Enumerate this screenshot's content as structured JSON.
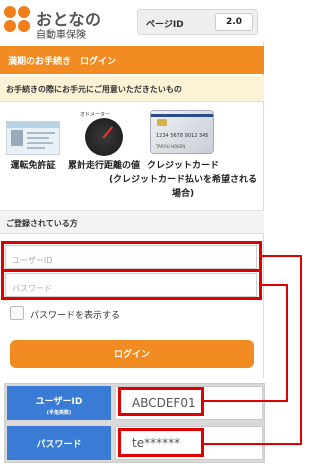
{
  "header": {
    "logo_main": "おとなの",
    "logo_sub": "自動車保険",
    "page_id_label": "ページID",
    "page_id_value": "2.0"
  },
  "title_bar": "満期のお手続き　ログイン",
  "notice": "お手続きの際にお手元にご用意いただきたいもの",
  "items": [
    {
      "caption": "運転免許証",
      "icon": "drivers-license-icon"
    },
    {
      "caption": "累計走行距離の値",
      "icon": "odometer-icon",
      "sublabel": "オドメーター"
    },
    {
      "caption": "クレジットカード\n(クレジットカード払いを希望される場合)",
      "icon": "credit-card-icon"
    }
  ],
  "card_number_text": "1234 5678 9012 345",
  "card_name_text": "TAROU HOKEN",
  "section_title": "ご登録されている方",
  "form": {
    "user_id_placeholder": "ユーザーID",
    "password_placeholder": "パスワード",
    "show_password_label": "パスワードを表示する",
    "login_label": "ログイン"
  },
  "table": {
    "user_id_label": "ユーザーID",
    "user_id_sub": "(半角英数)",
    "user_id_value": "ABCDEF01",
    "password_label": "パスワード",
    "password_value": "te******"
  },
  "colors": {
    "accent": "#f28b21",
    "highlight": "#e00000",
    "table_header": "#3a7bd5"
  }
}
